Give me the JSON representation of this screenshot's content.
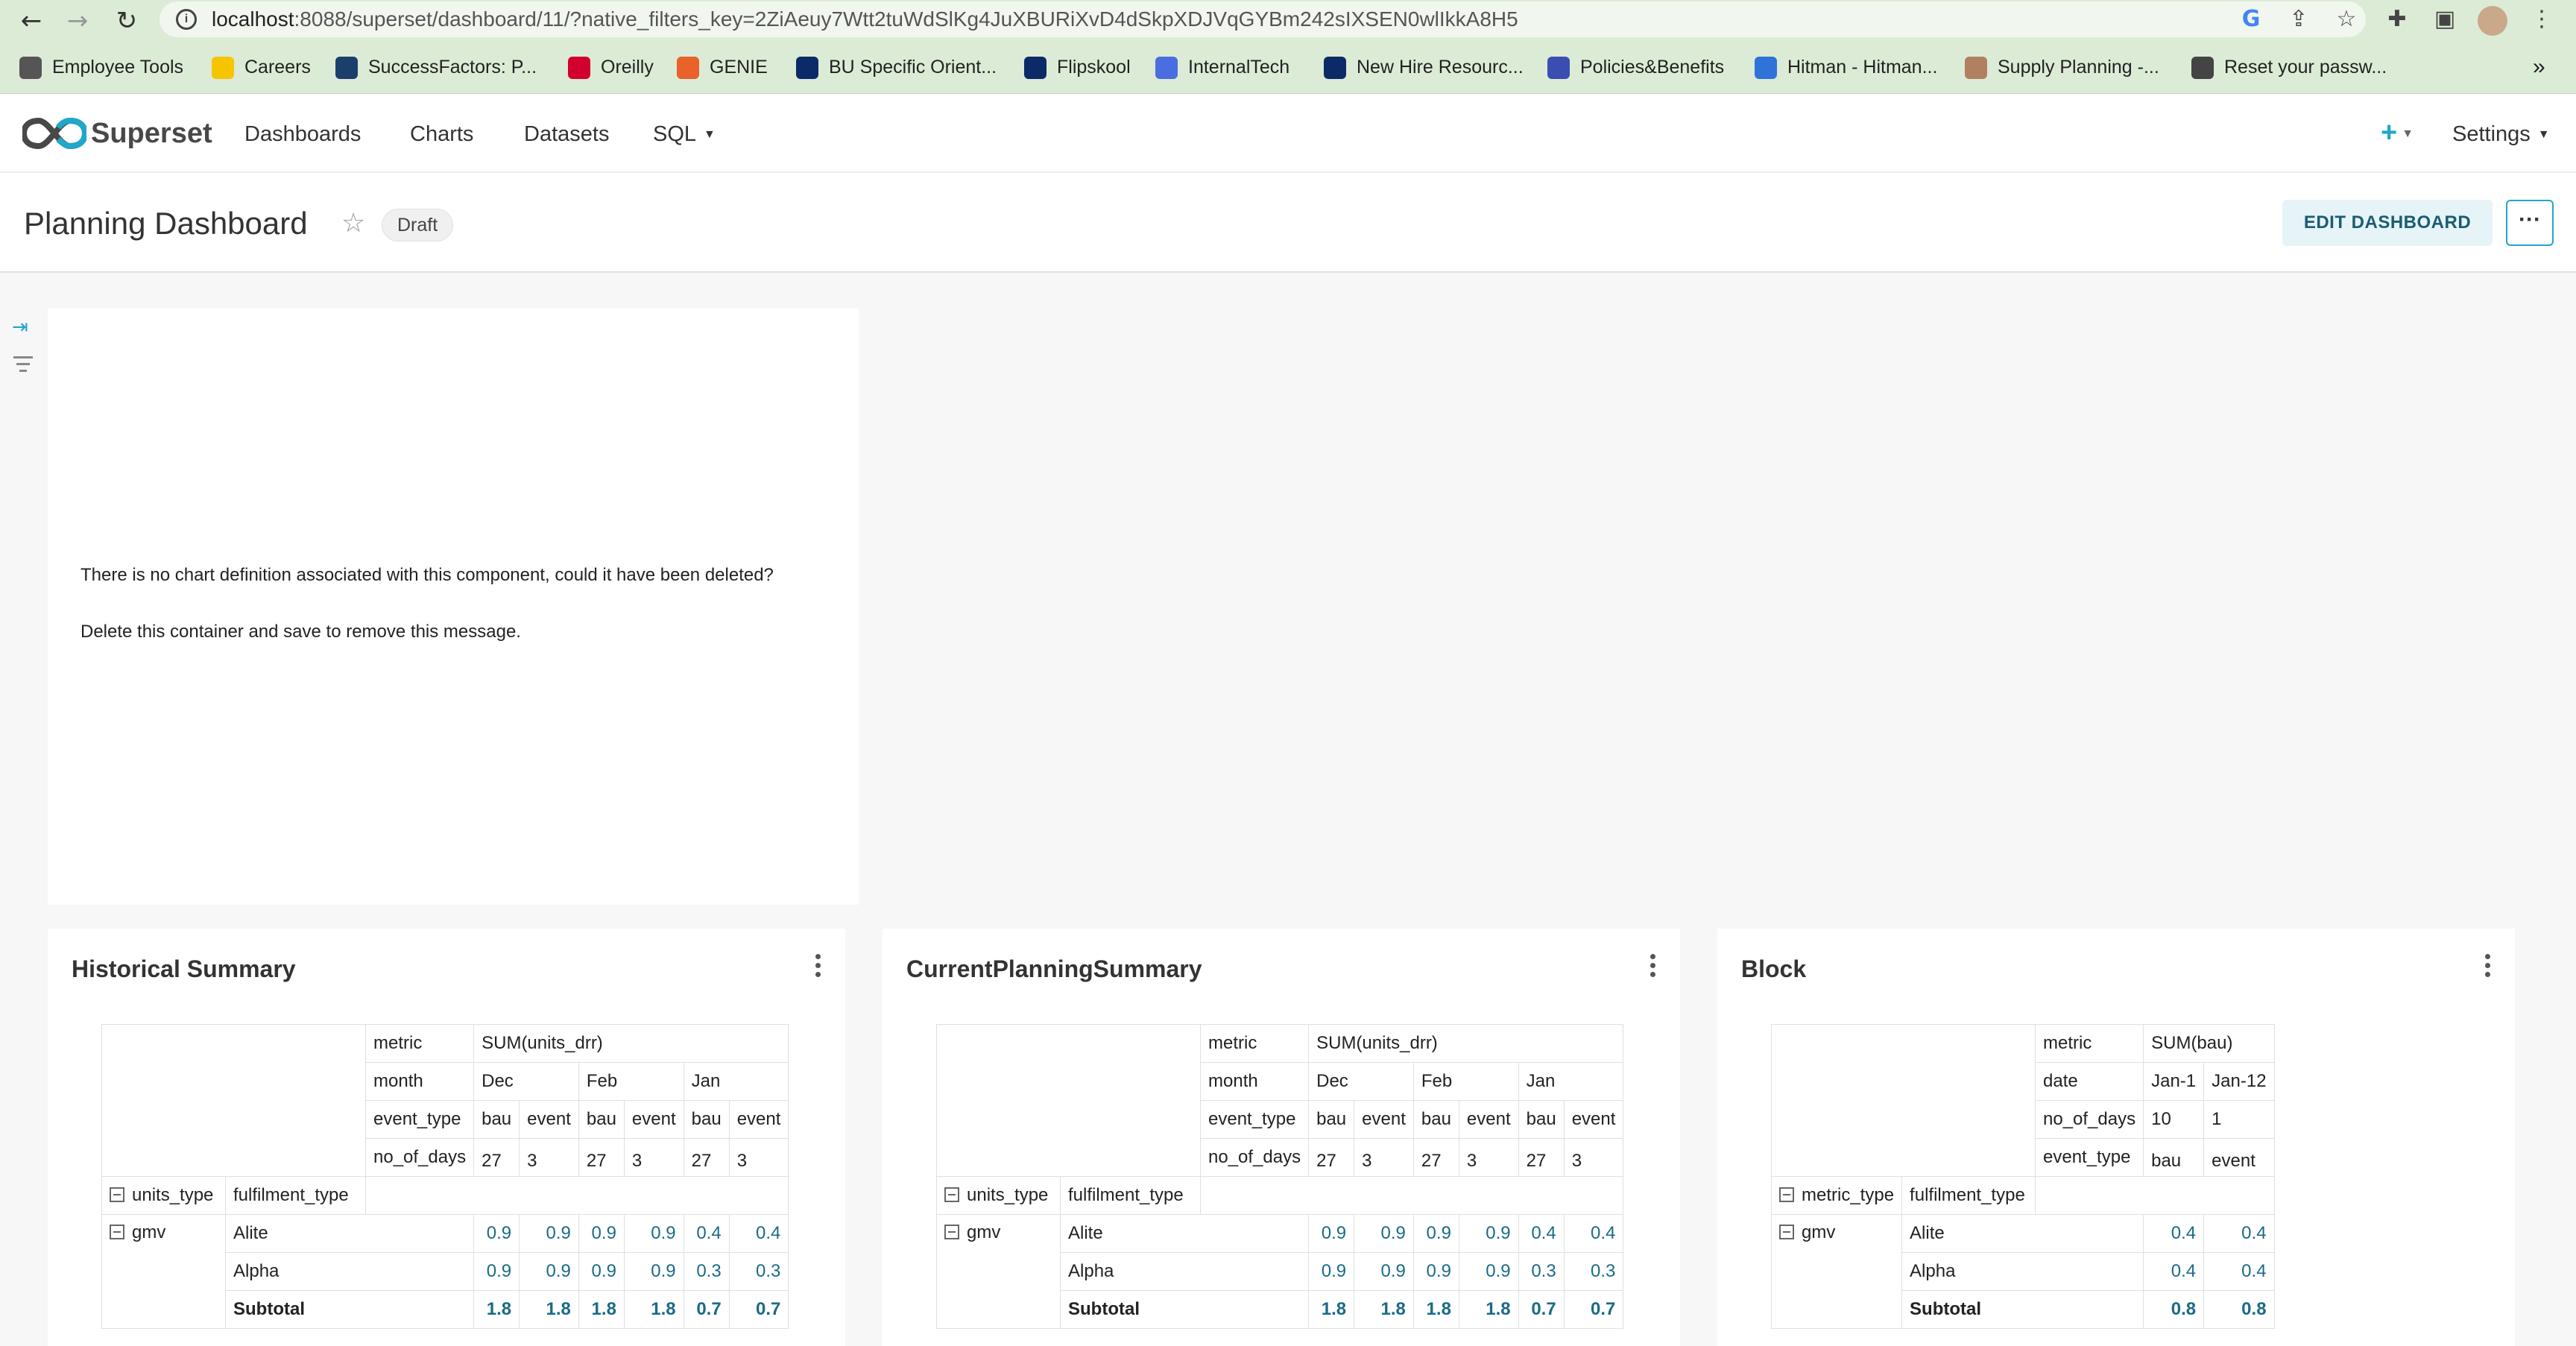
{
  "browser": {
    "url_host": "localhost",
    "url_rest": ":8088/superset/dashboard/11/?native_filters_key=2ZiAeuy7Wtt2tuWdSlKg4JuXBURiXvD4dSkpXDJVqGYBm242sIXSEN0wlIkkA8H5",
    "bookmarks": [
      {
        "label": "Employee Tools",
        "icon": "folder-icon",
        "color": "#555555"
      },
      {
        "label": "Careers",
        "icon": "flipkart-icon",
        "color": "#f7c500"
      },
      {
        "label": "SuccessFactors: P...",
        "icon": "successfactors-icon",
        "color": "#1b3f6b"
      },
      {
        "label": "Oreilly",
        "icon": "oreilly-icon",
        "color": "#d3002d"
      },
      {
        "label": "GENIE",
        "icon": "genie-icon",
        "color": "#e8622a"
      },
      {
        "label": "BU Specific Orient...",
        "icon": "flipkart-round-icon",
        "color": "#0c2a67"
      },
      {
        "label": "Flipskool",
        "icon": "flipkart-round-icon",
        "color": "#0c2a67"
      },
      {
        "label": "InternalTech",
        "icon": "docs-icon",
        "color": "#4a6ee0"
      },
      {
        "label": "New Hire Resourc...",
        "icon": "flipkart-round-icon",
        "color": "#0c2a67"
      },
      {
        "label": "Policies&Benefits",
        "icon": "forms-icon",
        "color": "#3a4db3"
      },
      {
        "label": "Hitman - Hitman...",
        "icon": "confluence-icon",
        "color": "#2f73d9"
      },
      {
        "label": "Supply Planning -...",
        "icon": "avatar-icon",
        "color": "#b08060"
      },
      {
        "label": "Reset your passw...",
        "icon": "globe-icon",
        "color": "#444444"
      }
    ],
    "overflow": "»"
  },
  "nav": {
    "brand": "Superset",
    "items": [
      "Dashboards",
      "Charts",
      "Datasets",
      "SQL"
    ],
    "plus": "+",
    "settings": "Settings"
  },
  "dashboard": {
    "title": "Planning Dashboard",
    "status": "Draft",
    "edit_label": "EDIT DASHBOARD",
    "more_label": "···"
  },
  "missing_chart": {
    "line1": "There is no chart definition associated with this component, could it have been deleted?",
    "line2": "Delete this container and save to remove this message."
  },
  "charts": [
    {
      "title": "Historical Summary",
      "header_rows": [
        {
          "label": "metric",
          "cells": [
            "SUM(units_drr)"
          ]
        },
        {
          "label": "month",
          "cells": [
            "Dec",
            "Feb",
            "Jan"
          ]
        },
        {
          "label": "event_type",
          "cells": [
            "bau",
            "event",
            "bau",
            "event",
            "bau",
            "event"
          ]
        },
        {
          "label": "no_of_days",
          "cells": [
            "27",
            "3",
            "27",
            "3",
            "27",
            "3"
          ]
        }
      ],
      "row_headers": [
        "units_type",
        "fulfilment_type"
      ],
      "group": "gmv",
      "rows": [
        {
          "name": "Alite",
          "values": [
            "0.9",
            "0.9",
            "0.9",
            "0.9",
            "0.4",
            "0.4"
          ]
        },
        {
          "name": "Alpha",
          "values": [
            "0.9",
            "0.9",
            "0.9",
            "0.9",
            "0.3",
            "0.3"
          ]
        },
        {
          "name": "Subtotal",
          "values": [
            "1.8",
            "1.8",
            "1.8",
            "1.8",
            "0.7",
            "0.7"
          ]
        }
      ]
    },
    {
      "title": "CurrentPlanningSummary",
      "header_rows": [
        {
          "label": "metric",
          "cells": [
            "SUM(units_drr)"
          ]
        },
        {
          "label": "month",
          "cells": [
            "Dec",
            "Feb",
            "Jan"
          ]
        },
        {
          "label": "event_type",
          "cells": [
            "bau",
            "event",
            "bau",
            "event",
            "bau",
            "event"
          ]
        },
        {
          "label": "no_of_days",
          "cells": [
            "27",
            "3",
            "27",
            "3",
            "27",
            "3"
          ]
        }
      ],
      "row_headers": [
        "units_type",
        "fulfilment_type"
      ],
      "group": "gmv",
      "rows": [
        {
          "name": "Alite",
          "values": [
            "0.9",
            "0.9",
            "0.9",
            "0.9",
            "0.4",
            "0.4"
          ]
        },
        {
          "name": "Alpha",
          "values": [
            "0.9",
            "0.9",
            "0.9",
            "0.9",
            "0.3",
            "0.3"
          ]
        },
        {
          "name": "Subtotal",
          "values": [
            "1.8",
            "1.8",
            "1.8",
            "1.8",
            "0.7",
            "0.7"
          ]
        }
      ]
    },
    {
      "title": "Block",
      "header_rows": [
        {
          "label": "metric",
          "cells": [
            "SUM(bau)"
          ]
        },
        {
          "label": "date",
          "cells": [
            "Jan-1",
            "Jan-12"
          ]
        },
        {
          "label": "no_of_days",
          "cells": [
            "10",
            "1"
          ]
        },
        {
          "label": "event_type",
          "cells": [
            "bau",
            "event"
          ]
        }
      ],
      "row_headers": [
        "metric_type",
        "fulfilment_type"
      ],
      "group": "gmv",
      "rows": [
        {
          "name": "Alite",
          "values": [
            "0.4",
            "0.4"
          ]
        },
        {
          "name": "Alpha",
          "values": [
            "0.4",
            "0.4"
          ]
        },
        {
          "name": "Subtotal",
          "values": [
            "0.8",
            "0.8"
          ]
        }
      ]
    }
  ]
}
